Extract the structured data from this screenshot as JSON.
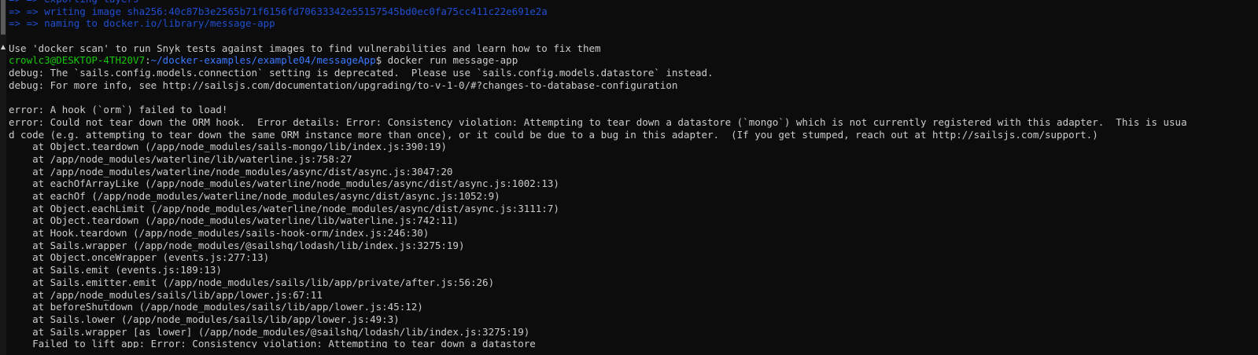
{
  "terminal": {
    "lines": [
      {
        "kind": "buildkit",
        "text": "=> => exporting layers"
      },
      {
        "kind": "buildkit",
        "text": "=> => writing image sha256:40c87b3e2565b71f6156fd70633342e55157545bd0ec0fa75cc411c22e691e2a"
      },
      {
        "kind": "buildkit",
        "text": "=> => naming to docker.io/library/message-app"
      },
      {
        "kind": "plain",
        "text": ""
      },
      {
        "kind": "plain",
        "text": "Use 'docker scan' to run Snyk tests against images to find vulnerabilities and learn how to fix them"
      },
      {
        "kind": "prompt",
        "user": "crowlc3@DESKTOP-4TH20V7",
        "sep": ":",
        "path": "~/docker-examples/example04/messageApp",
        "dollar": "$",
        "cmd": " docker run message-app"
      },
      {
        "kind": "plain",
        "text": "debug: The `sails.config.models.connection` setting is deprecated.  Please use `sails.config.models.datastore` instead."
      },
      {
        "kind": "plain",
        "text": "debug: For more info, see http://sailsjs.com/documentation/upgrading/to-v-1-0/#?changes-to-database-configuration"
      },
      {
        "kind": "plain",
        "text": ""
      },
      {
        "kind": "plain",
        "text": "error: A hook (`orm`) failed to load!"
      },
      {
        "kind": "plain",
        "text": "error: Could not tear down the ORM hook.  Error details: Error: Consistency violation: Attempting to tear down a datastore (`mongo`) which is not currently registered with this adapter.  This is usua"
      },
      {
        "kind": "plain",
        "text": "d code (e.g. attempting to tear down the same ORM instance more than once), or it could be due to a bug in this adapter.  (If you get stumped, reach out at http://sailsjs.com/support.)"
      },
      {
        "kind": "plain",
        "text": "    at Object.teardown (/app/node_modules/sails-mongo/lib/index.js:390:19)"
      },
      {
        "kind": "plain",
        "text": "    at /app/node_modules/waterline/lib/waterline.js:758:27"
      },
      {
        "kind": "plain",
        "text": "    at /app/node_modules/waterline/node_modules/async/dist/async.js:3047:20"
      },
      {
        "kind": "plain",
        "text": "    at eachOfArrayLike (/app/node_modules/waterline/node_modules/async/dist/async.js:1002:13)"
      },
      {
        "kind": "plain",
        "text": "    at eachOf (/app/node_modules/waterline/node_modules/async/dist/async.js:1052:9)"
      },
      {
        "kind": "plain",
        "text": "    at Object.eachLimit (/app/node_modules/waterline/node_modules/async/dist/async.js:3111:7)"
      },
      {
        "kind": "plain",
        "text": "    at Object.teardown (/app/node_modules/waterline/lib/waterline.js:742:11)"
      },
      {
        "kind": "plain",
        "text": "    at Hook.teardown (/app/node_modules/sails-hook-orm/index.js:246:30)"
      },
      {
        "kind": "plain",
        "text": "    at Sails.wrapper (/app/node_modules/@sailshq/lodash/lib/index.js:3275:19)"
      },
      {
        "kind": "plain",
        "text": "    at Object.onceWrapper (events.js:277:13)"
      },
      {
        "kind": "plain",
        "text": "    at Sails.emit (events.js:189:13)"
      },
      {
        "kind": "plain",
        "text": "    at Sails.emitter.emit (/app/node_modules/sails/lib/app/private/after.js:56:26)"
      },
      {
        "kind": "plain",
        "text": "    at /app/node_modules/sails/lib/app/lower.js:67:11"
      },
      {
        "kind": "plain",
        "text": "    at beforeShutdown (/app/node_modules/sails/lib/app/lower.js:45:12)"
      },
      {
        "kind": "plain",
        "text": "    at Sails.lower (/app/node_modules/sails/lib/app/lower.js:49:3)"
      },
      {
        "kind": "plain",
        "text": "    at Sails.wrapper [as lower] (/app/node_modules/@sailshq/lodash/lib/index.js:3275:19)"
      },
      {
        "kind": "plain",
        "text": "    Failed to lift app: Error: Consistency violation: Attempting to tear down a datastore"
      }
    ]
  },
  "scrollbar": {
    "up_arrow_glyph": "▲"
  },
  "colors": {
    "background": "#0c0c0c",
    "text": "#cccccc",
    "buildkit_blue": "#1f4fd1",
    "prompt_green": "#16c60c",
    "prompt_blue": "#3b78ff"
  }
}
